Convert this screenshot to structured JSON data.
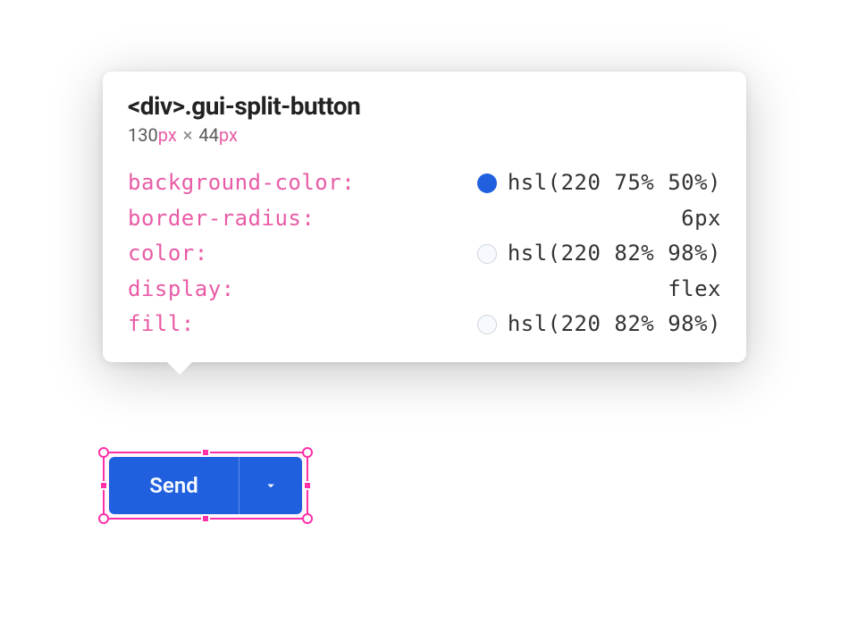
{
  "tooltip": {
    "selector_tag": "<div>",
    "selector_class": ".gui-split-button",
    "width": "130",
    "width_unit": "px",
    "height": "44",
    "height_unit": "px",
    "properties": [
      {
        "name": "background-color",
        "value": "hsl(220 75% 50%)",
        "swatch": "blue"
      },
      {
        "name": "border-radius",
        "value": "6px",
        "swatch": null
      },
      {
        "name": "color",
        "value": "hsl(220 82% 98%)",
        "swatch": "light"
      },
      {
        "name": "display",
        "value": "flex",
        "swatch": null
      },
      {
        "name": "fill",
        "value": "hsl(220 82% 98%)",
        "swatch": "light"
      }
    ]
  },
  "button": {
    "main_label": "Send"
  },
  "colors": {
    "primary": "hsl(220 75% 50%)",
    "on_primary": "hsl(220 82% 98%)",
    "selection": "#ff2fa8"
  }
}
